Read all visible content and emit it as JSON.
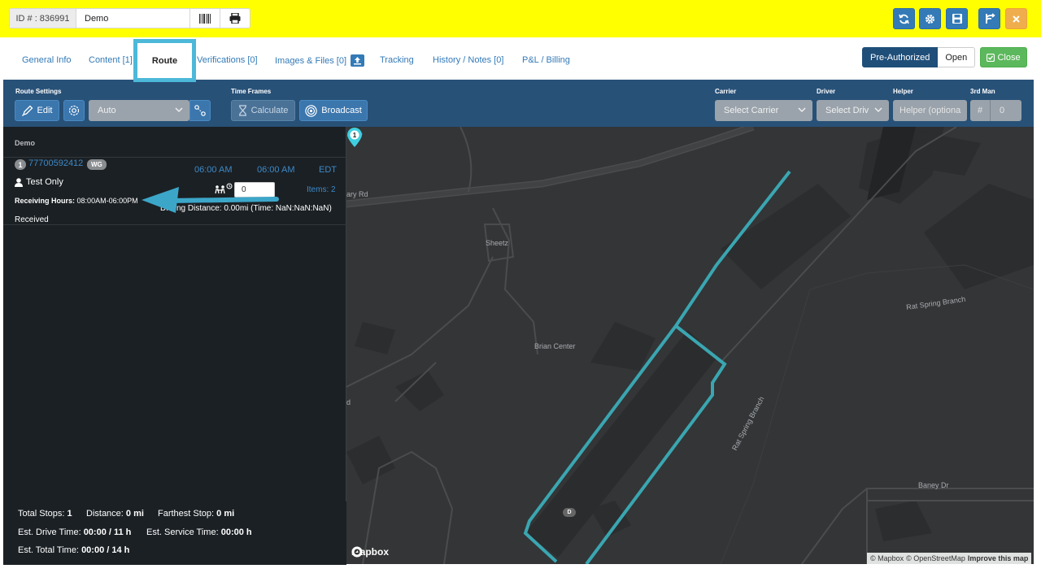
{
  "header": {
    "id_label": "ID # : 836991",
    "order_name": "Demo",
    "barcode_icon": "barcode-icon",
    "print_icon": "print-icon",
    "actions": [
      {
        "icon": "refresh-icon",
        "color": "#337ab7"
      },
      {
        "icon": "gear-icon",
        "color": "#337ab7"
      },
      {
        "icon": "save-icon",
        "color": "#337ab7"
      },
      {
        "icon": "route-split-icon",
        "color": "#337ab7"
      },
      {
        "icon": "close-icon",
        "color": "#f0ad4e"
      }
    ]
  },
  "tabs": {
    "general": "General Info",
    "content": "Content [1]",
    "route": "Route",
    "verifications": "Verifications [0]",
    "images": "Images & Files [0]",
    "tracking": "Tracking",
    "history": "History / Notes [0]",
    "billing": "P&L / Billing",
    "active": "Route"
  },
  "status": {
    "pre_authorized": "Pre-Authorized",
    "open": "Open",
    "close": "Close"
  },
  "route_settings": {
    "label": "Route Settings",
    "edit": "Edit",
    "mode": "Auto",
    "time_frames_label": "Time Frames",
    "calculate": "Calculate",
    "broadcast": "Broadcast",
    "carrier_label": "Carrier",
    "carrier_value": "Select Carrier",
    "driver_label": "Driver",
    "driver_value": "Select Driv",
    "helper_label": "Helper",
    "helper_placeholder": "Helper (optiona",
    "third_man_label": "3rd Man",
    "third_man_hash": "#",
    "third_man_value": "0"
  },
  "stops_panel": {
    "title": "Demo",
    "stop": {
      "number": "1",
      "id": "77700592412",
      "badge": "WG",
      "time_start": "06:00 AM",
      "time_end": "06:00 AM",
      "timezone": "EDT",
      "contact": "Test Only",
      "quantity": "0",
      "items": "Items: 2",
      "receiving_hours_label": "Receiving Hours:",
      "receiving_hours_value": "08:00AM-06:00PM",
      "driving_distance": "Driving Distance: 0.00mi (Time: NaN:NaN:NaN)",
      "status": "Received"
    }
  },
  "stats": {
    "total_stops_label": "Total Stops:",
    "total_stops": "1",
    "distance_label": "Distance:",
    "distance": "0 mi",
    "farthest_label": "Farthest Stop:",
    "farthest": "0 mi",
    "drive_time_label": "Est. Drive Time:",
    "drive_time": "00:00 / 11 h",
    "service_time_label": "Est. Service Time:",
    "service_time": "00:00 h",
    "total_time_label": "Est. Total Time:",
    "total_time": "00:00 / 14 h"
  },
  "map": {
    "labels": {
      "road_top": "ary Rd",
      "sheetz": "Sheetz",
      "brian_center": "Brian Center",
      "rat_spring_branch_1": "Rat Spring Branch",
      "rat_spring_branch_2": "Rat Spring Branch",
      "baney_dr": "Baney Dr",
      "left_edge": "d"
    },
    "pin_number": "1",
    "pin_label": "D",
    "logo": "mapbox",
    "attribution_1": "© Mapbox",
    "attribution_2": "© OpenStreetMap",
    "improve": "Improve this map",
    "route_color": "#3aa6b1"
  }
}
